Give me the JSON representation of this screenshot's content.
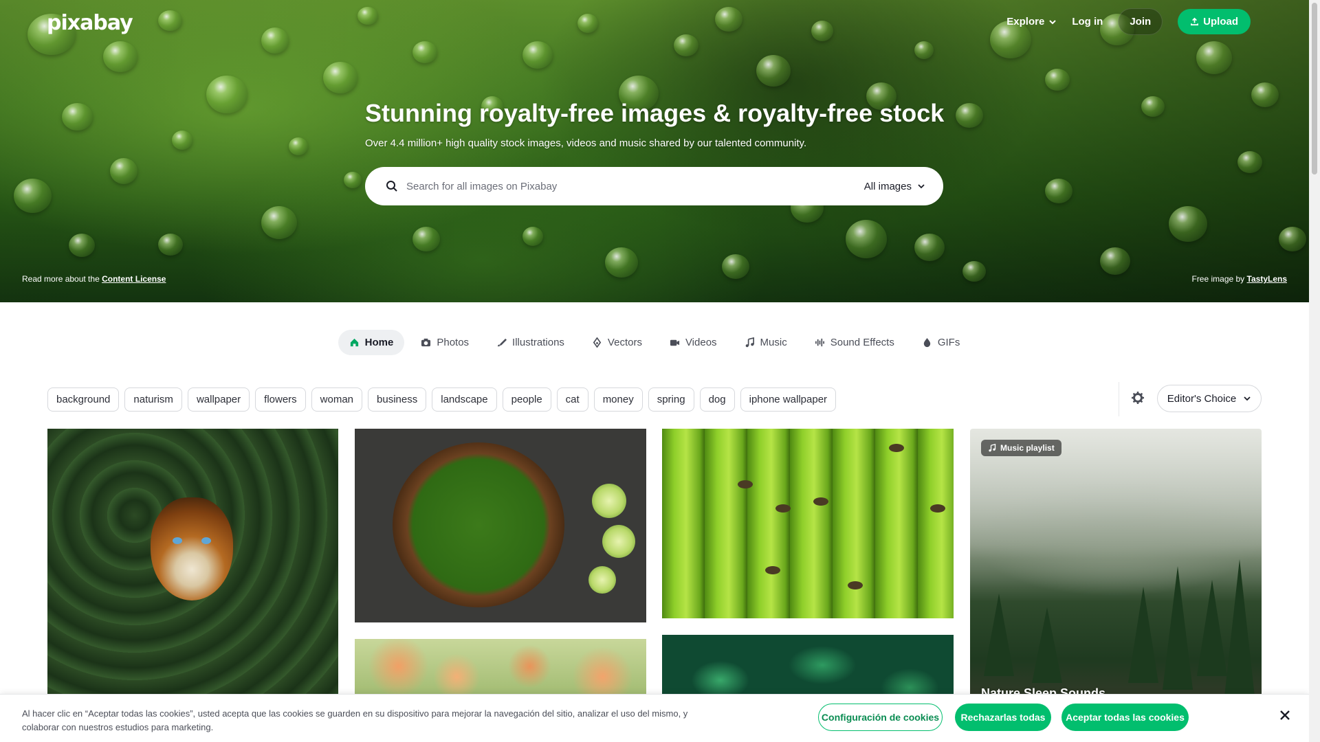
{
  "header": {
    "logo": "pixabay",
    "nav": {
      "explore": "Explore",
      "login": "Log in",
      "join": "Join",
      "upload": "Upload"
    }
  },
  "hero": {
    "title": "Stunning royalty-free images & royalty-free stock",
    "subtitle": "Over 4.4 million+ high quality stock images, videos and music shared by our talented community.",
    "search": {
      "placeholder": "Search for all images on Pixabay",
      "type": "All images"
    },
    "license_prefix": "Read more about the ",
    "license_link": "Content License",
    "credit_prefix": "Free image by ",
    "credit_link": "TastyLens"
  },
  "tabs": [
    {
      "label": "Home",
      "icon": "home-icon",
      "active": true
    },
    {
      "label": "Photos",
      "icon": "camera-icon"
    },
    {
      "label": "Illustrations",
      "icon": "brush-icon"
    },
    {
      "label": "Vectors",
      "icon": "pen-icon"
    },
    {
      "label": "Videos",
      "icon": "video-icon"
    },
    {
      "label": "Music",
      "icon": "music-icon"
    },
    {
      "label": "Sound Effects",
      "icon": "waveform-icon"
    },
    {
      "label": "GIFs",
      "icon": "gif-icon"
    }
  ],
  "tags": [
    "background",
    "naturism",
    "wallpaper",
    "flowers",
    "woman",
    "business",
    "landscape",
    "people",
    "cat",
    "money",
    "spring",
    "dog",
    "iphone wallpaper"
  ],
  "sort": {
    "label": "Editor's Choice"
  },
  "grid": {
    "playlist_badge": "Music playlist",
    "playlist_title": "Nature Sleep Sounds"
  },
  "cookie": {
    "text": "Al hacer clic en “Aceptar todas las cookies”, usted acepta que las cookies se guarden en su dispositivo para mejorar la navegación del sitio, analizar el uso del mismo, y colaborar con nuestros estudios para marketing.",
    "config": "Configuración de cookies",
    "reject": "Rechazarlas todas",
    "accept": "Aceptar todas las cookies"
  },
  "colors": {
    "accent": "#02be6e",
    "text": "#191b26"
  }
}
